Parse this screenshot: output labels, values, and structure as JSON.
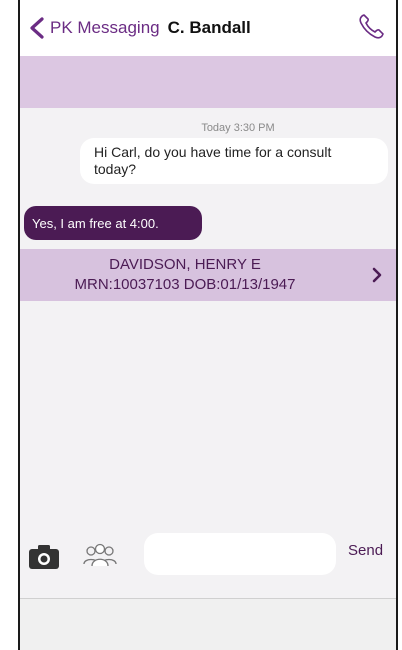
{
  "header": {
    "back_label": "PK Messaging",
    "contact_name": "C. Bandall",
    "back_icon": "chevron-left-icon",
    "call_icon": "phone-icon"
  },
  "thread": {
    "timestamp": "Today 3:30 PM",
    "messages": [
      {
        "direction": "incoming",
        "text": "Hi Carl, do you have time for a consult today?"
      },
      {
        "direction": "outgoing",
        "text": "Yes, I am free at 4:00."
      }
    ]
  },
  "patient": {
    "name": "DAVIDSON, HENRY E",
    "ids": "MRN:10037103 DOB:01/13/1947"
  },
  "composer": {
    "input_value": "",
    "send_label": "Send",
    "camera_icon": "camera-icon",
    "group_icon": "group-icon"
  },
  "colors": {
    "accent": "#6b2c84",
    "outgoing_bubble": "#4b1b54",
    "banner": "#dcc7e2",
    "patient_bar": "#d7c2de"
  }
}
